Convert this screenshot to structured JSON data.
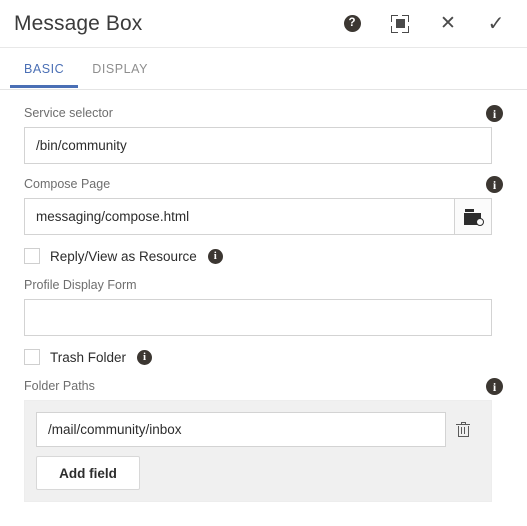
{
  "header": {
    "title": "Message Box",
    "actions": [
      {
        "name": "help-icon",
        "label": "?"
      },
      {
        "name": "maximize-icon",
        "label": ""
      },
      {
        "name": "close-icon",
        "label": "✕"
      },
      {
        "name": "confirm-icon",
        "label": "✓"
      }
    ]
  },
  "tabs": [
    {
      "label": "BASIC",
      "active": true
    },
    {
      "label": "DISPLAY",
      "active": false
    }
  ],
  "form": {
    "service_selector": {
      "label": "Service selector",
      "value": "/bin/community",
      "placeholder": "",
      "info": "i"
    },
    "compose_page": {
      "label": "Compose Page",
      "value": "messaging/compose.html",
      "placeholder": "",
      "info": "i",
      "browse_title": "Browse"
    },
    "reply_view_as_resource": {
      "label": "Reply/View as Resource",
      "checked": false,
      "info": "i"
    },
    "profile_display_form": {
      "label": "Profile Display Form",
      "value": "",
      "placeholder": ""
    },
    "trash_folder": {
      "label": "Trash Folder",
      "checked": false,
      "info": "i"
    },
    "folder_paths": {
      "label": "Folder Paths",
      "info": "i",
      "items": [
        {
          "value": "/mail/community/inbox",
          "placeholder": ""
        }
      ],
      "add_label": "Add field",
      "delete_title": "Delete"
    }
  },
  "colors": {
    "accent": "#4a6fb5",
    "label": "#6e6e6e",
    "text": "#2c2c2c",
    "border": "#d3d3d3",
    "panel": "#f0f0f0"
  }
}
